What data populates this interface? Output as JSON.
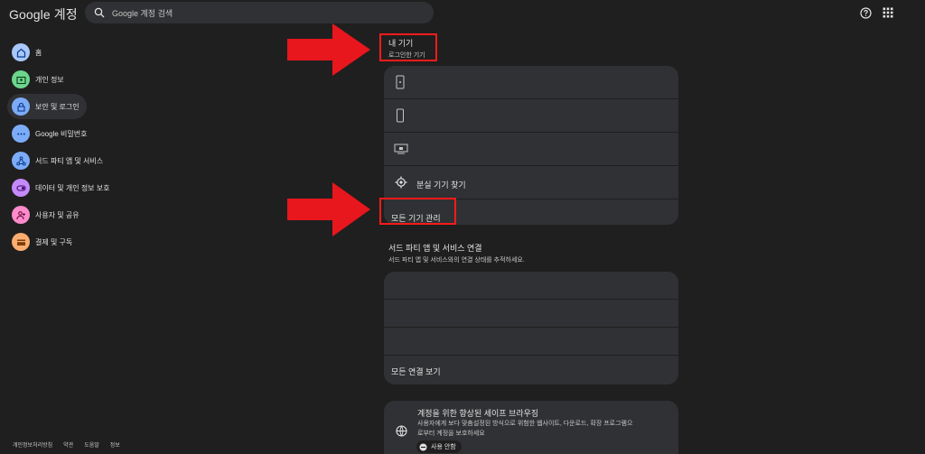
{
  "header": {
    "brand": "Google 계정",
    "search_placeholder": "Google 계정 검색",
    "icons": [
      "search-icon",
      "help-icon",
      "apps-icon"
    ]
  },
  "sidebar": {
    "items": [
      {
        "label": "홈",
        "icon": "home-icon",
        "color": "#a8c7fa",
        "active": false
      },
      {
        "label": "개인 정보",
        "icon": "id-card-icon",
        "color": "#6dd58c",
        "active": false
      },
      {
        "label": "보안 및 로그인",
        "icon": "lock-icon",
        "color": "#7cacf8",
        "active": true
      },
      {
        "label": "Google 비밀번호",
        "icon": "password-icon",
        "color": "#7cacf8",
        "active": false
      },
      {
        "label": "서드 파티 앱 및 서비스",
        "icon": "connected-apps-icon",
        "color": "#7cacf8",
        "active": false
      },
      {
        "label": "데이터 및 개인 정보 보호",
        "icon": "toggle-icon",
        "color": "#c58af9",
        "active": false
      },
      {
        "label": "사용자 및 공유",
        "icon": "people-icon",
        "color": "#ff8bcb",
        "active": false
      },
      {
        "label": "결제 및 구독",
        "icon": "wallet-icon",
        "color": "#fcad70",
        "active": false
      }
    ]
  },
  "devices": {
    "title": "내 기기",
    "subtitle": "로그인한 기기",
    "find_device": "분실 기기 찾기",
    "manage_all": "모든 기기 관리"
  },
  "third_party": {
    "title": "서드 파티 앱 및 서비스 연결",
    "subtitle": "서드 파티 앱 및 서비스와의 연결 상태를 추적하세요.",
    "view_all": "모든 연결 보기"
  },
  "safe_browsing": {
    "title": "계정을 위한 향상된 세이프 브라우징",
    "description_line1": "사용자에게 보다 맞춤설정된 방식으로 위험한 웹사이트, 다운로드, 확장 프로그램으",
    "description_line2": "로부터 계정을 보호하세요",
    "status": "사용 안함"
  },
  "footer": {
    "links": [
      "개인정보처리방침",
      "약관",
      "도움말",
      "정보"
    ]
  },
  "colors": {
    "background": "#1f1f1f",
    "card": "#303134",
    "highlight": "#ff1a1a"
  }
}
